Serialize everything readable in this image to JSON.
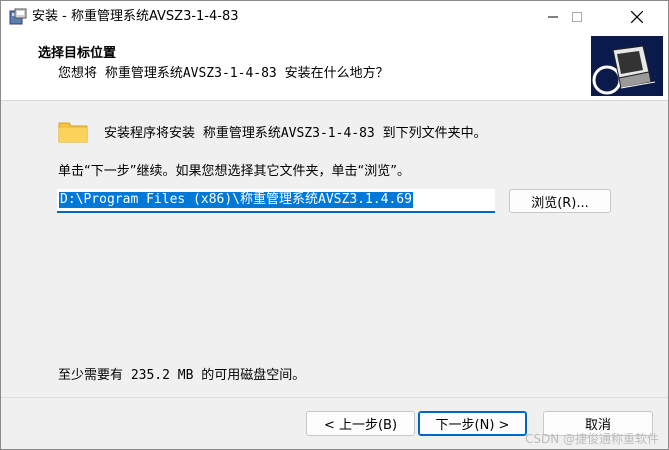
{
  "window": {
    "title": "安装 - 称重管理系统AVSZ3-1-4-83"
  },
  "header": {
    "title": "选择目标位置",
    "subtitle": "您想将 称重管理系统AVSZ3-1-4-83 安装在什么地方？"
  },
  "body": {
    "intro": "安装程序将安装 称重管理系统AVSZ3-1-4-83 到下列文件夹中。",
    "instruction": "单击“下一步”继续。如果您想选择其它文件夹，单击“浏览”。",
    "path_value": "D:\\Program Files (x86)\\称重管理系统AVSZ3.1.4.69",
    "browse_label": "浏览(R)...",
    "space_required": "至少需要有 235.2 MB 的可用磁盘空间。"
  },
  "footer": {
    "back_label": "< 上一步(B)",
    "next_label": "下一步(N) >",
    "cancel_label": "取消"
  },
  "watermark": "CSDN @捷俊通称重软件",
  "colors": {
    "accent": "#0078d7",
    "focus_border": "#0067c0",
    "folder": "#f5c342"
  }
}
